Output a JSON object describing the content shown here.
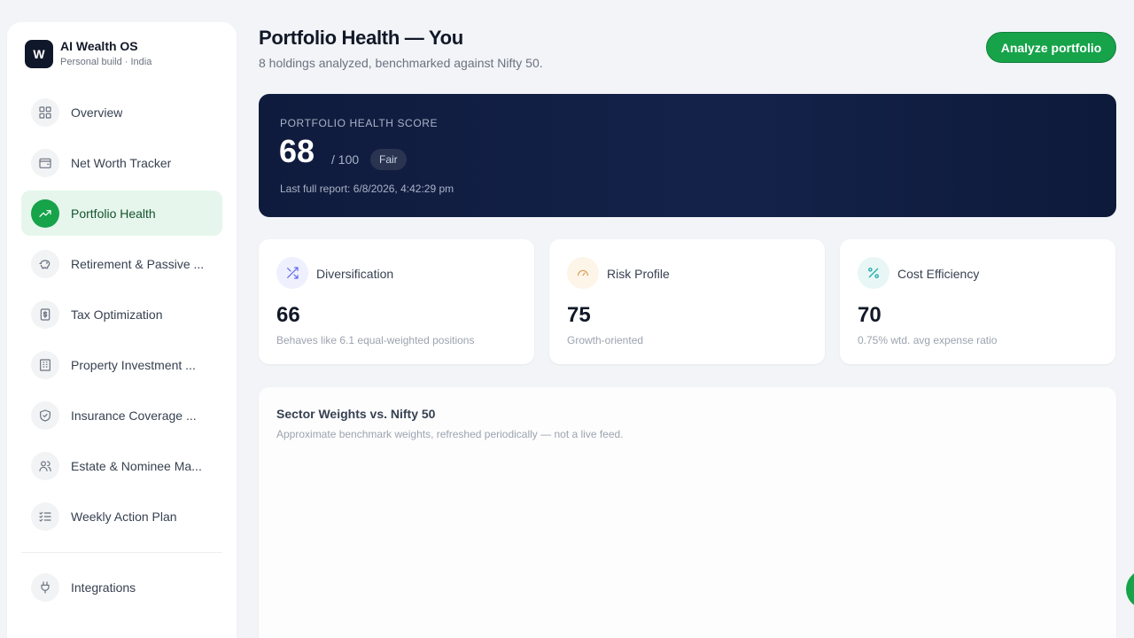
{
  "app": {
    "logo_letter": "W",
    "name": "AI Wealth OS",
    "subtitle": "Personal build · India"
  },
  "sidebar": {
    "items": [
      {
        "label": "Overview",
        "icon": "grid-icon"
      },
      {
        "label": "Net Worth Tracker",
        "icon": "wallet-icon"
      },
      {
        "label": "Portfolio Health",
        "icon": "trending-up-icon",
        "active": true
      },
      {
        "label": "Retirement & Passive ...",
        "icon": "piggy-bank-icon"
      },
      {
        "label": "Tax Optimization",
        "icon": "receipt-icon"
      },
      {
        "label": "Property Investment ...",
        "icon": "building-icon"
      },
      {
        "label": "Insurance Coverage ...",
        "icon": "shield-icon"
      },
      {
        "label": "Estate & Nominee Ma...",
        "icon": "users-icon"
      },
      {
        "label": "Weekly Action Plan",
        "icon": "list-checks-icon"
      }
    ],
    "bottom_items": [
      {
        "label": "Integrations",
        "icon": "plug-icon"
      }
    ]
  },
  "header": {
    "title": "Portfolio Health — You",
    "subtitle": "8 holdings analyzed, benchmarked against Nifty 50.",
    "action_label": "Analyze portfolio"
  },
  "health": {
    "label": "PORTFOLIO HEALTH SCORE",
    "score": "68",
    "out_of": "/ 100",
    "rating": "Fair",
    "last_report": "Last full report: 6/8/2026, 4:42:29 pm"
  },
  "metrics": [
    {
      "title": "Diversification",
      "value": "66",
      "description": "Behaves like 6.1 equal-weighted positions",
      "icon": "shuffle-icon",
      "accent": "#6366f1"
    },
    {
      "title": "Risk Profile",
      "value": "75",
      "description": "Growth-oriented",
      "icon": "gauge-icon",
      "accent": "#d97706"
    },
    {
      "title": "Cost Efficiency",
      "value": "70",
      "description": "0.75% wtd. avg expense ratio",
      "icon": "percent-icon",
      "accent": "#0ea5a4"
    }
  ],
  "sector": {
    "title": "Sector Weights vs. Nifty 50",
    "subtitle": "Approximate benchmark weights, refreshed periodically — not a live feed."
  },
  "colors": {
    "accent": "#16a34a",
    "hero_bg": "#0f1b3d"
  }
}
